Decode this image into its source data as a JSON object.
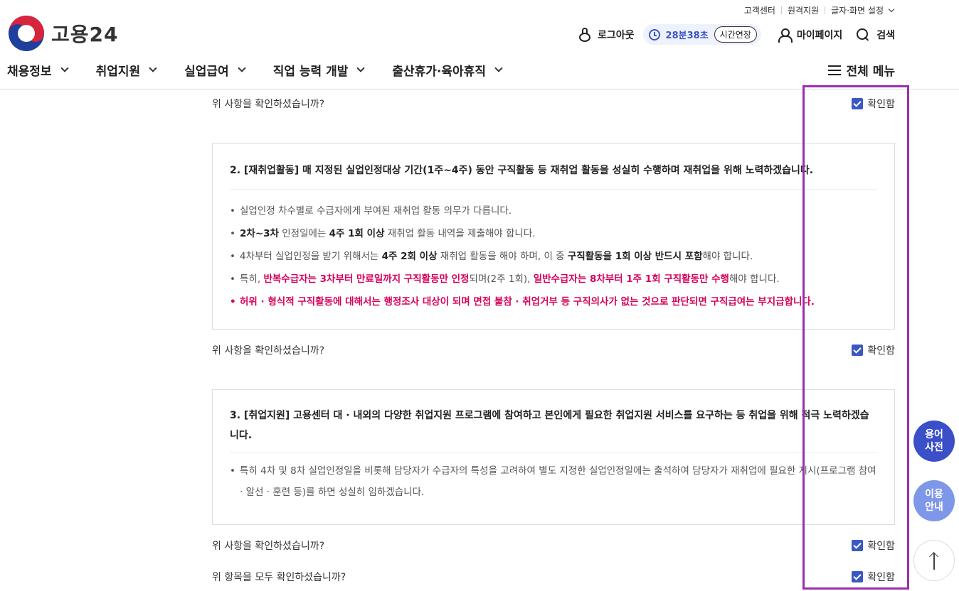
{
  "utility": {
    "customer_center": "고객센터",
    "remote_support": "원격지원",
    "display_settings": "글자·화면 설정"
  },
  "logo": {
    "text": "고용24"
  },
  "header": {
    "logout": "로그아웃",
    "timer": "28분38초",
    "extend": "시간연장",
    "mypage": "마이페이지",
    "search": "검색"
  },
  "nav": {
    "items": [
      "채용정보",
      "취업지원",
      "실업급여",
      "직업 능력 개발",
      "출산휴가·육아휴직"
    ],
    "all_menu": "전체 메뉴"
  },
  "confirm": {
    "question": "위 사항을 확인하셨습니까?",
    "question_all": "위 항목을 모두 확인하셨습니까?",
    "label": "확인함"
  },
  "card2": {
    "title": "2. [재취업활동] 매 지정된 실업인정대상 기간(1주~4주) 동안 구직활동 등 재취업 활동을 성실히 수행하며 재취업을 위해 노력하겠습니다.",
    "b1": "실업인정 차수별로 수급자에게 부여된 재취업 활동 의무가 다릅니다.",
    "b2_a": "2차~3차",
    "b2_b": " 인정일에는 ",
    "b2_c": "4주 1회 이상",
    "b2_d": " 재취업 활동 내역을 제출해야 합니다.",
    "b3_a": "4차부터 실업인정을 받기 위해서는 ",
    "b3_b": "4주 2회 이상",
    "b3_c": " 재취업 활동을 해야 하며, 이 중 ",
    "b3_d": "구직활동을 1회 이상 반드시 포함",
    "b3_e": "해야 합니다.",
    "b4_a": "특히, ",
    "b4_b": "반복수급자는 3차부터 만료일까지 구직활동만 인정",
    "b4_c": "되며(2주 1회), ",
    "b4_d": "일반수급자는 8차부터 1주 1회 구직활동만 수행",
    "b4_e": "해야 합니다.",
    "b5": "허위 · 형식적 구직활동에 대해서는 행정조사 대상이 되며 면접 불참 · 취업거부 등 구직의사가 없는 것으로 판단되면 구직급여는 부지급합니다."
  },
  "card3": {
    "title": "3. [취업지원] 고용센터 대 · 내외의 다양한 취업지원 프로그램에 참여하고 본인에게 필요한 취업지원 서비스를 요구하는 등 취업을 위해 적극 노력하겠습니다.",
    "b1": "특히 4차 및 8차 실업인정일을 비롯해 담당자가 수급자의 특성을 고려하여 별도 지정한 실업인정일에는 출석하여 담당자가 재취업에 필요한 지시(프로그램 참여 · 알선 · 훈련 등)를 하면 성실히 임하겠습니다."
  },
  "floating": {
    "dict": "용어 사전",
    "guide": "이용 안내"
  },
  "colors": {
    "accent": "#3a58c4",
    "emphasis": "#d6005a",
    "highlight": "#9b2fae"
  }
}
